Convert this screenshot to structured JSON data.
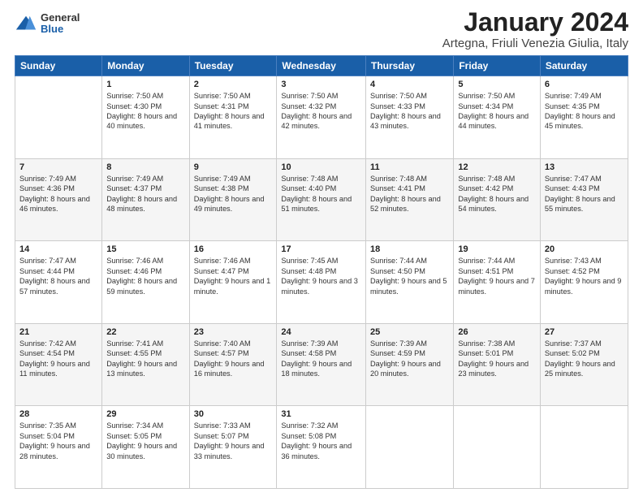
{
  "header": {
    "logo_general": "General",
    "logo_blue": "Blue",
    "title": "January 2024",
    "subtitle": "Artegna, Friuli Venezia Giulia, Italy"
  },
  "weekdays": [
    "Sunday",
    "Monday",
    "Tuesday",
    "Wednesday",
    "Thursday",
    "Friday",
    "Saturday"
  ],
  "weeks": [
    [
      {
        "day": "",
        "sunrise": "",
        "sunset": "",
        "daylight": ""
      },
      {
        "day": "1",
        "sunrise": "Sunrise: 7:50 AM",
        "sunset": "Sunset: 4:30 PM",
        "daylight": "Daylight: 8 hours and 40 minutes."
      },
      {
        "day": "2",
        "sunrise": "Sunrise: 7:50 AM",
        "sunset": "Sunset: 4:31 PM",
        "daylight": "Daylight: 8 hours and 41 minutes."
      },
      {
        "day": "3",
        "sunrise": "Sunrise: 7:50 AM",
        "sunset": "Sunset: 4:32 PM",
        "daylight": "Daylight: 8 hours and 42 minutes."
      },
      {
        "day": "4",
        "sunrise": "Sunrise: 7:50 AM",
        "sunset": "Sunset: 4:33 PM",
        "daylight": "Daylight: 8 hours and 43 minutes."
      },
      {
        "day": "5",
        "sunrise": "Sunrise: 7:50 AM",
        "sunset": "Sunset: 4:34 PM",
        "daylight": "Daylight: 8 hours and 44 minutes."
      },
      {
        "day": "6",
        "sunrise": "Sunrise: 7:49 AM",
        "sunset": "Sunset: 4:35 PM",
        "daylight": "Daylight: 8 hours and 45 minutes."
      }
    ],
    [
      {
        "day": "7",
        "sunrise": "Sunrise: 7:49 AM",
        "sunset": "Sunset: 4:36 PM",
        "daylight": "Daylight: 8 hours and 46 minutes."
      },
      {
        "day": "8",
        "sunrise": "Sunrise: 7:49 AM",
        "sunset": "Sunset: 4:37 PM",
        "daylight": "Daylight: 8 hours and 48 minutes."
      },
      {
        "day": "9",
        "sunrise": "Sunrise: 7:49 AM",
        "sunset": "Sunset: 4:38 PM",
        "daylight": "Daylight: 8 hours and 49 minutes."
      },
      {
        "day": "10",
        "sunrise": "Sunrise: 7:48 AM",
        "sunset": "Sunset: 4:40 PM",
        "daylight": "Daylight: 8 hours and 51 minutes."
      },
      {
        "day": "11",
        "sunrise": "Sunrise: 7:48 AM",
        "sunset": "Sunset: 4:41 PM",
        "daylight": "Daylight: 8 hours and 52 minutes."
      },
      {
        "day": "12",
        "sunrise": "Sunrise: 7:48 AM",
        "sunset": "Sunset: 4:42 PM",
        "daylight": "Daylight: 8 hours and 54 minutes."
      },
      {
        "day": "13",
        "sunrise": "Sunrise: 7:47 AM",
        "sunset": "Sunset: 4:43 PM",
        "daylight": "Daylight: 8 hours and 55 minutes."
      }
    ],
    [
      {
        "day": "14",
        "sunrise": "Sunrise: 7:47 AM",
        "sunset": "Sunset: 4:44 PM",
        "daylight": "Daylight: 8 hours and 57 minutes."
      },
      {
        "day": "15",
        "sunrise": "Sunrise: 7:46 AM",
        "sunset": "Sunset: 4:46 PM",
        "daylight": "Daylight: 8 hours and 59 minutes."
      },
      {
        "day": "16",
        "sunrise": "Sunrise: 7:46 AM",
        "sunset": "Sunset: 4:47 PM",
        "daylight": "Daylight: 9 hours and 1 minute."
      },
      {
        "day": "17",
        "sunrise": "Sunrise: 7:45 AM",
        "sunset": "Sunset: 4:48 PM",
        "daylight": "Daylight: 9 hours and 3 minutes."
      },
      {
        "day": "18",
        "sunrise": "Sunrise: 7:44 AM",
        "sunset": "Sunset: 4:50 PM",
        "daylight": "Daylight: 9 hours and 5 minutes."
      },
      {
        "day": "19",
        "sunrise": "Sunrise: 7:44 AM",
        "sunset": "Sunset: 4:51 PM",
        "daylight": "Daylight: 9 hours and 7 minutes."
      },
      {
        "day": "20",
        "sunrise": "Sunrise: 7:43 AM",
        "sunset": "Sunset: 4:52 PM",
        "daylight": "Daylight: 9 hours and 9 minutes."
      }
    ],
    [
      {
        "day": "21",
        "sunrise": "Sunrise: 7:42 AM",
        "sunset": "Sunset: 4:54 PM",
        "daylight": "Daylight: 9 hours and 11 minutes."
      },
      {
        "day": "22",
        "sunrise": "Sunrise: 7:41 AM",
        "sunset": "Sunset: 4:55 PM",
        "daylight": "Daylight: 9 hours and 13 minutes."
      },
      {
        "day": "23",
        "sunrise": "Sunrise: 7:40 AM",
        "sunset": "Sunset: 4:57 PM",
        "daylight": "Daylight: 9 hours and 16 minutes."
      },
      {
        "day": "24",
        "sunrise": "Sunrise: 7:39 AM",
        "sunset": "Sunset: 4:58 PM",
        "daylight": "Daylight: 9 hours and 18 minutes."
      },
      {
        "day": "25",
        "sunrise": "Sunrise: 7:39 AM",
        "sunset": "Sunset: 4:59 PM",
        "daylight": "Daylight: 9 hours and 20 minutes."
      },
      {
        "day": "26",
        "sunrise": "Sunrise: 7:38 AM",
        "sunset": "Sunset: 5:01 PM",
        "daylight": "Daylight: 9 hours and 23 minutes."
      },
      {
        "day": "27",
        "sunrise": "Sunrise: 7:37 AM",
        "sunset": "Sunset: 5:02 PM",
        "daylight": "Daylight: 9 hours and 25 minutes."
      }
    ],
    [
      {
        "day": "28",
        "sunrise": "Sunrise: 7:35 AM",
        "sunset": "Sunset: 5:04 PM",
        "daylight": "Daylight: 9 hours and 28 minutes."
      },
      {
        "day": "29",
        "sunrise": "Sunrise: 7:34 AM",
        "sunset": "Sunset: 5:05 PM",
        "daylight": "Daylight: 9 hours and 30 minutes."
      },
      {
        "day": "30",
        "sunrise": "Sunrise: 7:33 AM",
        "sunset": "Sunset: 5:07 PM",
        "daylight": "Daylight: 9 hours and 33 minutes."
      },
      {
        "day": "31",
        "sunrise": "Sunrise: 7:32 AM",
        "sunset": "Sunset: 5:08 PM",
        "daylight": "Daylight: 9 hours and 36 minutes."
      },
      {
        "day": "",
        "sunrise": "",
        "sunset": "",
        "daylight": ""
      },
      {
        "day": "",
        "sunrise": "",
        "sunset": "",
        "daylight": ""
      },
      {
        "day": "",
        "sunrise": "",
        "sunset": "",
        "daylight": ""
      }
    ]
  ]
}
